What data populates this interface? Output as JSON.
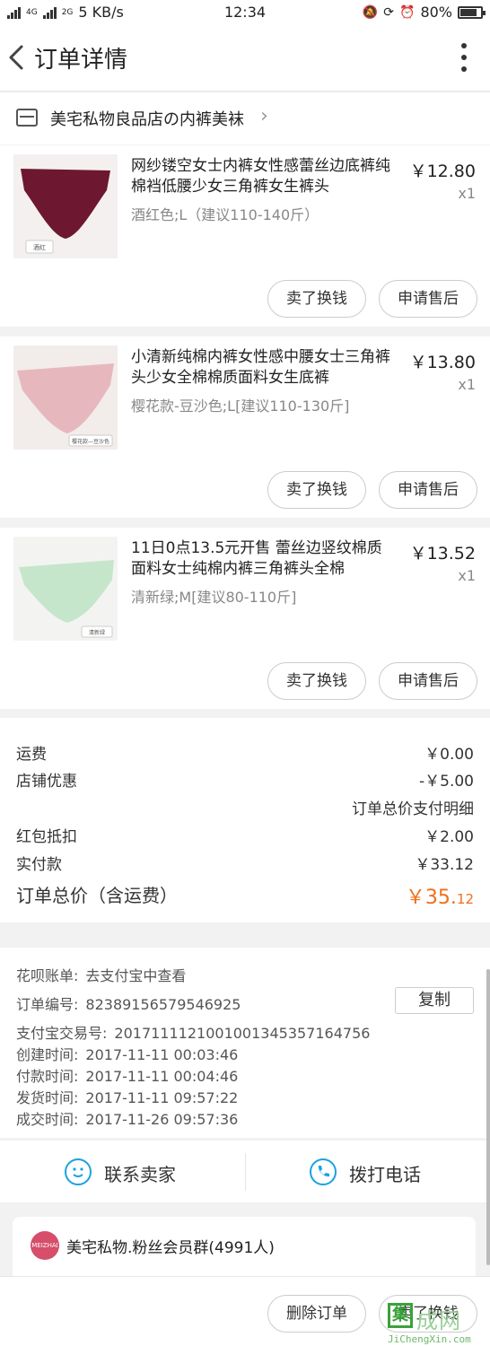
{
  "status_bar": {
    "network_small": "4G",
    "network_small2": "2G",
    "speed": "5 KB/s",
    "time": "12:34",
    "battery": "80%",
    "battery_level": 0.8
  },
  "nav": {
    "back_glyph": "‹",
    "title": "订单详情",
    "more_icon": "more-vertical-icon"
  },
  "shop": {
    "icon": "store-icon",
    "name": "美宅私物良品店の内裤美袜",
    "arrow": "›"
  },
  "items": [
    {
      "title": "网纱镂空女士内裤女性感蕾丝边底裤纯棉裆低腰少女三角裤女生裤头",
      "spec": "酒红色;L（建议110-140斤）",
      "price": "￥12.80",
      "qty": "x1",
      "thumb_label": "酒红",
      "thumb_color": "#6d1830",
      "thumb_bg": "#f4f0ef",
      "btn_sell": "卖了换钱",
      "btn_after": "申请售后"
    },
    {
      "title": "小清新纯棉内裤女性感中腰女士三角裤头少女全棉棉质面料女生底裤",
      "spec": "樱花款-豆沙色;L[建议110-130斤]",
      "price": "￥13.80",
      "qty": "x1",
      "thumb_label": "樱花款—豆沙色",
      "thumb_color": "#e6b8bd",
      "thumb_bg": "#f2ecea",
      "btn_sell": "卖了换钱",
      "btn_after": "申请售后"
    },
    {
      "title": "11日0点13.5元开售 蕾丝边竖纹棉质面料女士纯棉内裤三角裤头全棉",
      "spec": "清新绿;M[建议80-110斤]",
      "price": "￥13.52",
      "qty": "x1",
      "thumb_label": "清新绿",
      "thumb_color": "#c6e6cc",
      "thumb_bg": "#f3f4f2",
      "btn_sell": "卖了换钱",
      "btn_after": "申请售后"
    }
  ],
  "summary": {
    "shipping_label": "运费",
    "shipping_value": "￥0.00",
    "discount_label": "店铺优惠",
    "discount_value": "-￥5.00",
    "detail_link": "订单总价支付明细",
    "redpacket_label": "红包抵扣",
    "redpacket_value": "￥2.00",
    "paid_label": "实付款",
    "paid_value": "￥33.12",
    "total_label": "订单总价（含运费）",
    "total_currency": "￥",
    "total_int": "35.",
    "total_dec": "12",
    "total_color": "#f06f1b"
  },
  "info": {
    "huabei_label": "花呗账单:",
    "huabei_value": "去支付宝中查看",
    "order_no_label": "订单编号:",
    "order_no_value": "82389156579546925",
    "copy_label": "复制",
    "alipay_label": "支付宝交易号:",
    "alipay_value": "2017111121001001345357164756",
    "created_label": "创建时间:",
    "created_value": "2017-11-11 00:03:46",
    "paid_label": "付款时间:",
    "paid_value": "2017-11-11 00:04:46",
    "shipped_label": "发货时间:",
    "shipped_value": "2017-11-11 09:57:22",
    "done_label": "成交时间:",
    "done_value": "2017-11-26 09:57:36"
  },
  "contact": {
    "seller_icon": "chat-smile-icon",
    "seller_label": "联系卖家",
    "phone_icon": "phone-icon",
    "phone_label": "拨打电话",
    "accent": "#1aa2e0"
  },
  "group": {
    "logo_text": "MEIZHAI",
    "name": "美宅私物.粉丝会员群(4991人)"
  },
  "bottom": {
    "delete_label": "删除订单",
    "sell_label": "卖了换钱"
  },
  "watermark": {
    "box_char": "集",
    "text": "成网",
    "url": "JiChengXin.com"
  }
}
